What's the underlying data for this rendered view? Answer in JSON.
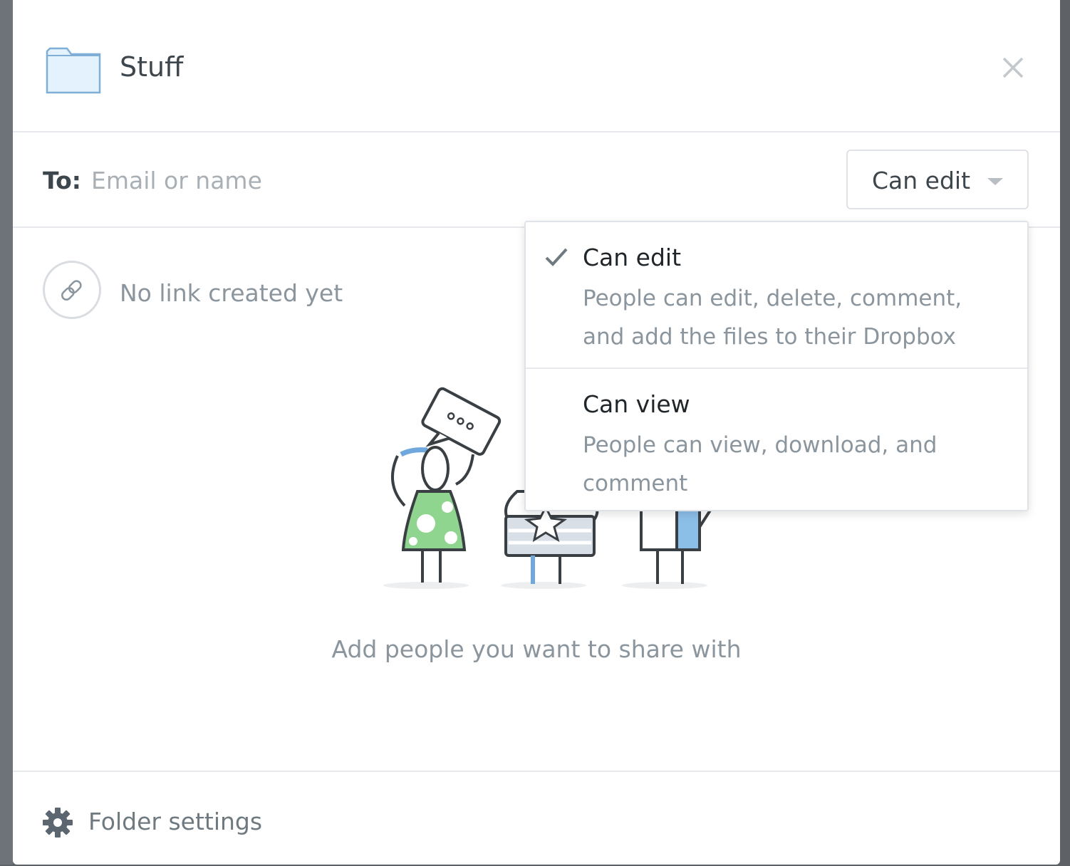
{
  "dialog": {
    "title": "Stuff",
    "icons": {
      "folder": "folder-icon",
      "close": "close-icon"
    }
  },
  "share": {
    "to_label": "To:",
    "input_placeholder": "Email or name",
    "input_value": "",
    "permission_selected": "Can edit"
  },
  "link": {
    "status_text": "No link created yet",
    "icon": "link-icon"
  },
  "empty_state": {
    "message": "Add people you want to share with"
  },
  "footer": {
    "settings_label": "Folder settings",
    "icon": "gear-icon"
  },
  "permission_menu": {
    "options": [
      {
        "title": "Can edit",
        "description": "People can edit, delete, comment, and add the files to their Dropbox",
        "selected": true
      },
      {
        "title": "Can view",
        "description": "People can view, download, and comment",
        "selected": false
      }
    ]
  },
  "colors": {
    "text_dark": "#3d464d",
    "text_muted": "#8b959d",
    "folder_fill": "#e3f2fc",
    "folder_stroke": "#7faed6",
    "divider": "#e6e8eb"
  }
}
